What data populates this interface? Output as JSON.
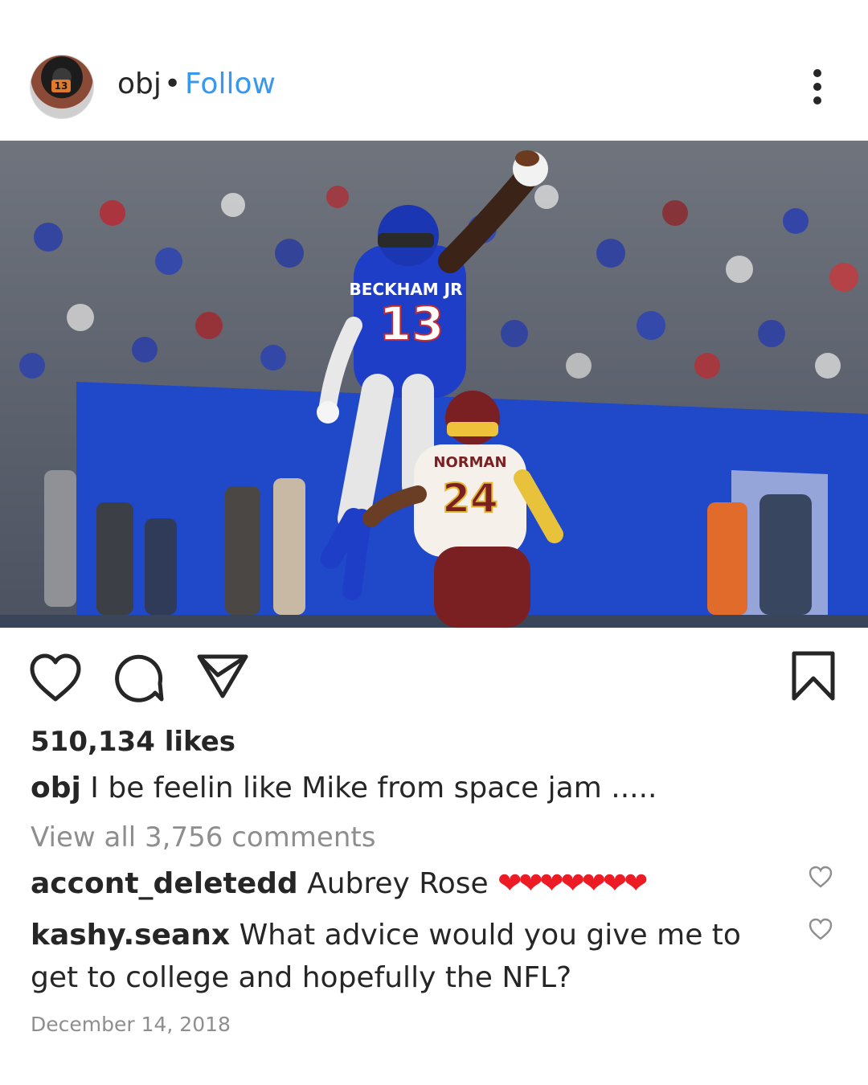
{
  "post": {
    "username": "obj",
    "separator": "•",
    "follow_label": "Follow",
    "avatar_jersey_number": "13",
    "photo": {
      "player_front_name": "BECKHAM JR",
      "player_front_number": "13",
      "player_back_name": "NORMAN",
      "player_back_number": "24"
    },
    "likes_text": "510,134 likes",
    "caption_user": "obj",
    "caption_text": " I be feelin like Mike from space jam .....",
    "view_all_comments": "View all 3,756 comments",
    "comments": [
      {
        "user": "accont_deletedd",
        "text": " Aubrey Rose ",
        "emoji": "❤❤❤❤❤❤❤"
      },
      {
        "user": "kashy.seanx",
        "text": " What advice would you give me to get to college and hopefully the NFL?"
      }
    ],
    "date": "December 14, 2018"
  },
  "icons": {
    "more": "more-options-icon",
    "like": "heart-icon",
    "comment": "comment-bubble-icon",
    "share": "send-icon",
    "save": "bookmark-icon",
    "comment_like": "small-heart-icon"
  },
  "colors": {
    "text": "#262626",
    "secondary": "#8e8e8e",
    "link": "#3897f0",
    "giants_blue": "#1e3ec7",
    "redskins_burgundy": "#7a1f22",
    "heart_red": "#ed1b24"
  }
}
